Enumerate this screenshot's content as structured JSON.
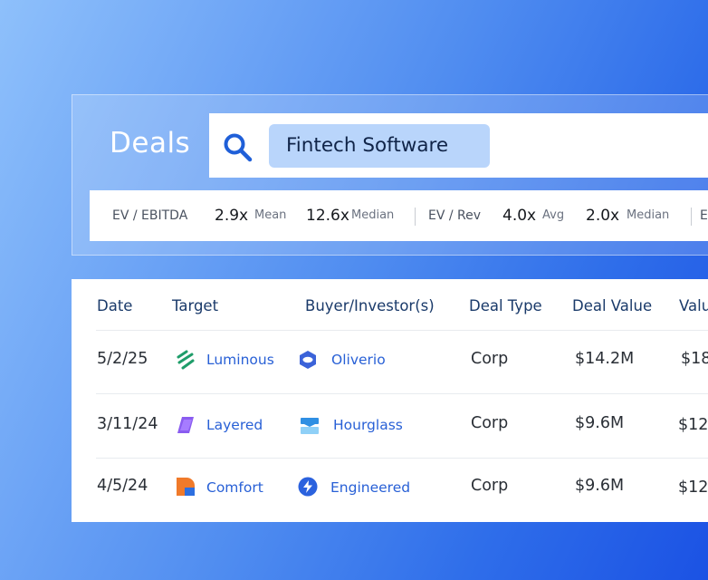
{
  "header": {
    "title": "Deals"
  },
  "search": {
    "query": "Fintech Software"
  },
  "metrics": [
    {
      "label": "EV / EBITDA"
    },
    {
      "value": "2.9x",
      "sub": "Mean"
    },
    {
      "value": "12.6x",
      "sub": "Median"
    },
    {
      "label": "EV / Rev"
    },
    {
      "value": "4.0x",
      "sub": "Avg"
    },
    {
      "value": "2.0x",
      "sub": "Median"
    },
    {
      "label": "E"
    }
  ],
  "table": {
    "headers": [
      "Date",
      "Target",
      "Buyer/Investor(s)",
      "Deal Type",
      "Deal Value",
      "Valu"
    ],
    "rows": [
      {
        "date": "5/2/25",
        "target": "Luminous",
        "target_logo": "luminous-logo",
        "buyer": "Oliverio",
        "buyer_logo": "oliverio-logo",
        "type": "Corp",
        "value": "$14.2M",
        "valuation": "$18"
      },
      {
        "date": "3/11/24",
        "target": "Layered",
        "target_logo": "layered-logo",
        "buyer": "Hourglass",
        "buyer_logo": "hourglass-logo",
        "type": "Corp",
        "value": "$9.6M",
        "valuation": "$12"
      },
      {
        "date": "4/5/24",
        "target": "Comfort",
        "target_logo": "comfort-logo",
        "buyer": "Engineered",
        "buyer_logo": "engineered-logo",
        "type": "Corp",
        "value": "$9.6M",
        "valuation": "$12"
      }
    ]
  },
  "colors": {
    "accent": "#2860d6",
    "chip": "#b9d5fb",
    "heading": "#1a3a6a"
  }
}
